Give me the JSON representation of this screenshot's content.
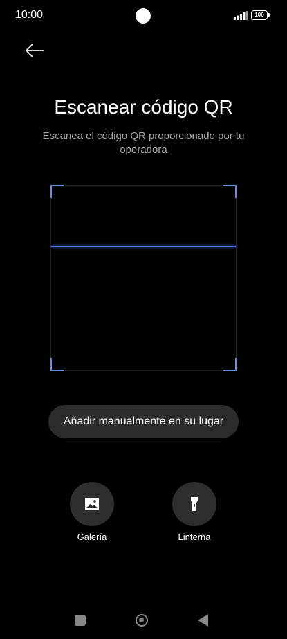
{
  "status_bar": {
    "time": "10:00",
    "battery": "100"
  },
  "header": {
    "back_icon": "arrow-left-icon"
  },
  "title": "Escanear código QR",
  "subtitle": "Escanea el código QR proporcionado por tu operadora",
  "scanner": {
    "accent_color": "#6a8ee0",
    "line_color": "#5877e6"
  },
  "manual_button": {
    "label": "Añadir manualmente en su lugar"
  },
  "actions": [
    {
      "label": "Galería",
      "icon": "image-icon"
    },
    {
      "label": "Linterna",
      "icon": "flashlight-icon"
    }
  ],
  "nav_bar": {
    "recents_icon": "square-icon",
    "home_icon": "circle-home-icon",
    "back_icon": "triangle-back-icon"
  }
}
